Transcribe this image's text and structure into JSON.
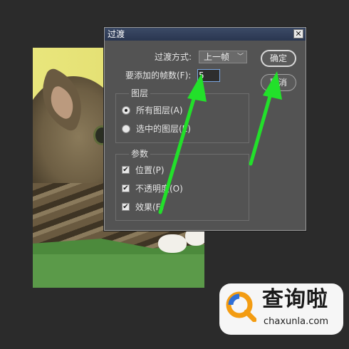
{
  "dialog": {
    "title": "过渡",
    "close_glyph": "✕",
    "method_label": "过渡方式:",
    "method_value": "上一帧",
    "frames_label": "要添加的帧数(F):",
    "frames_value": "5",
    "layers_group_label": "图层",
    "layers_options": [
      "所有图层(A)",
      "选中的图层(E)"
    ],
    "layers_selected": "所有图层(A)",
    "params_group_label": "参数",
    "params": [
      {
        "label": "位置(P)",
        "checked": true
      },
      {
        "label": "不透明度(O)",
        "checked": true
      },
      {
        "label": "效果(F)",
        "checked": true
      }
    ],
    "ok_label": "确定",
    "cancel_label": "取消",
    "check_glyph": "✔"
  },
  "annotations": {
    "arrow_color": "#22e02a"
  },
  "watermark": {
    "brand": "查询啦",
    "url": "chaxunla.com",
    "accent": "#f39c12",
    "accent2": "#2f6fd6"
  }
}
